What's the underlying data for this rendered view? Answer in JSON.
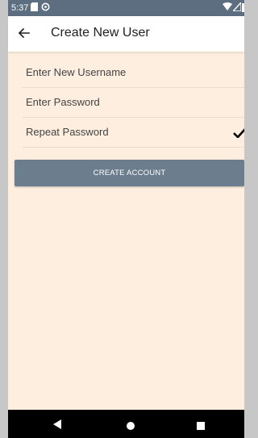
{
  "status_bar": {
    "time": "5:37"
  },
  "app_bar": {
    "title": "Create New User"
  },
  "form": {
    "username_placeholder": "Enter New Username",
    "password_placeholder": "Enter Password",
    "repeat_password_placeholder": "Repeat Password"
  },
  "buttons": {
    "create_account": "CREATE ACCOUNT"
  },
  "icons": {
    "back": "arrow-back-icon",
    "check": "check-icon",
    "nav_back": "triangle-back-icon",
    "nav_home": "circle-home-icon",
    "nav_recents": "square-recents-icon"
  },
  "colors": {
    "background": "#fdeedf",
    "app_bar": "#ffffff",
    "button": "#6c7e8e",
    "status_bar": "#5c6e80"
  }
}
